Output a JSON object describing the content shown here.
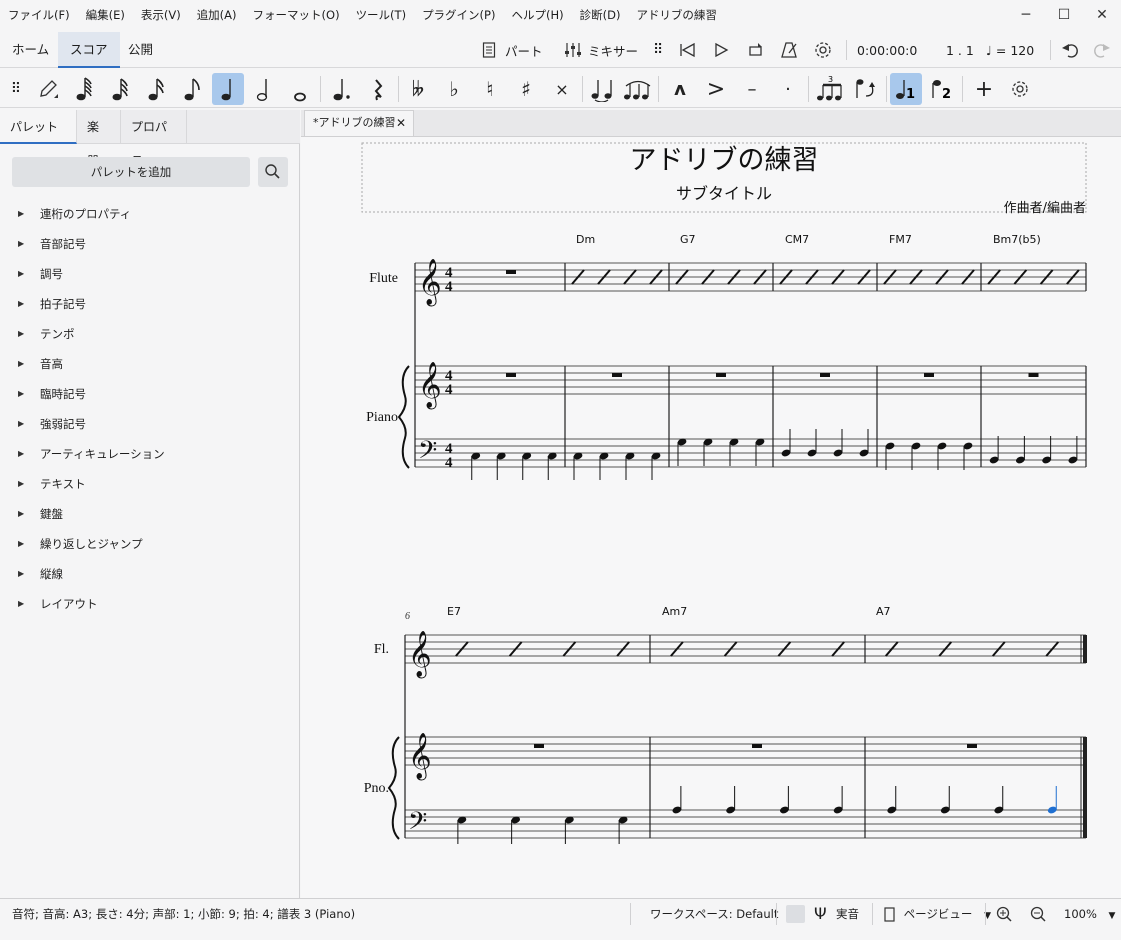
{
  "menubar": {
    "items": [
      "ファイル(F)",
      "編集(E)",
      "表示(V)",
      "追加(A)",
      "フォーマット(O)",
      "ツール(T)",
      "プラグイン(P)",
      "ヘルプ(H)",
      "診断(D)",
      "アドリブの練習"
    ]
  },
  "window_controls": {
    "minimize": "─",
    "maximize": "☐",
    "close": "✕"
  },
  "nav": {
    "tabs": [
      "ホーム",
      "スコア",
      "公開"
    ],
    "active_tab": "スコア",
    "parts_label": "パート",
    "mixer_label": "ミキサー",
    "time": "0:00:00:0",
    "position": "1 . 1",
    "tempo": "♩ = 120"
  },
  "note_toolbar": {
    "selected_duration": "quarter",
    "voice_selected": "1"
  },
  "left_panel": {
    "tabs": [
      "パレット",
      "楽器",
      "プロパティ"
    ],
    "tab_dots": "⋯",
    "add_palette": "パレットを追加",
    "palettes": [
      "連桁のプロパティ",
      "音部記号",
      "調号",
      "拍子記号",
      "テンポ",
      "音高",
      "臨時記号",
      "強弱記号",
      "アーティキュレーション",
      "テキスト",
      "鍵盤",
      "繰り返しとジャンプ",
      "縦線",
      "レイアウト"
    ]
  },
  "document_tab": {
    "label": "*アドリブの練習",
    "close": "✕"
  },
  "score": {
    "title": "アドリブの練習",
    "subtitle": "サブタイトル",
    "composer": "作曲者/編曲者",
    "system1": {
      "instruments": [
        "Flute",
        "Piano"
      ],
      "chords": [
        "Dm",
        "G7",
        "CM7",
        "FM7",
        "Bm7(b5)"
      ]
    },
    "system2": {
      "measure_number": "6",
      "instruments": [
        "Fl.",
        "Pno."
      ],
      "chords": [
        "E7",
        "Am7",
        "A7"
      ]
    }
  },
  "statusbar": {
    "note_info": "音符; 音高: A3; 長さ: 4分; 声部: 1; 小節: 9; 拍: 4; 譜表 3 (Piano)",
    "workspace": "ワークスペース: Default",
    "concert_pitch": "実音",
    "view_mode": "ページビュー",
    "zoom": "100%"
  },
  "colors": {
    "accent": "#2f6ec2",
    "selected_note": "#1f6fd1",
    "toolbar_selected": "#a8c8ec"
  }
}
